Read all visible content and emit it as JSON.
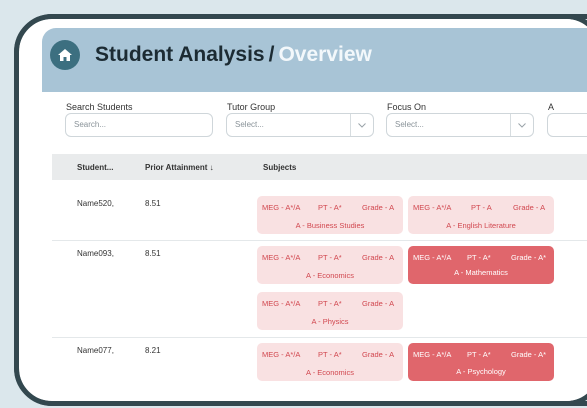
{
  "header": {
    "title": "Student Analysis",
    "separator": "/",
    "subtitle": "Overview",
    "home_icon": "home-icon"
  },
  "filters": {
    "search": {
      "label": "Search Students",
      "placeholder": "Search..."
    },
    "tutor": {
      "label": "Tutor Group",
      "value": "Select..."
    },
    "focus": {
      "label": "Focus On",
      "value": "Select..."
    },
    "extra": {
      "label": "A"
    }
  },
  "table": {
    "headers": {
      "student": "Student...",
      "prior": "Prior Attainment",
      "subjects": "Subjects"
    },
    "rows": [
      {
        "student": "Name520,",
        "prior": "8.51"
      },
      {
        "student": "Name093,",
        "prior": "8.51"
      },
      {
        "student": "Name077,",
        "prior": "8.21"
      }
    ],
    "cards": [
      {
        "meg": "MEG - A*/A",
        "pt": "PT - A*",
        "grade": "Grade - A",
        "subject": "A - Business Studies"
      },
      {
        "meg": "MEG - A*/A",
        "pt": "PT - A",
        "grade": "Grade - A",
        "subject": "A - English Literature"
      },
      {
        "meg": "MEG - A*/A",
        "pt": "PT - A*",
        "grade": "Grade - A",
        "subject": "A - Economics"
      },
      {
        "meg": "MEG - A*/A",
        "pt": "PT - A*",
        "grade": "Grade - A*",
        "subject": "A - Mathematics"
      },
      {
        "meg": "MEG - A*/A",
        "pt": "PT - A*",
        "grade": "Grade - A",
        "subject": "A - Physics"
      },
      {
        "meg": "MEG - A*/A",
        "pt": "PT - A*",
        "grade": "Grade - A",
        "subject": "A - Economics"
      },
      {
        "meg": "MEG - A*/A",
        "pt": "PT - A*",
        "grade": "Grade - A*",
        "subject": "A - Psychology"
      }
    ]
  }
}
